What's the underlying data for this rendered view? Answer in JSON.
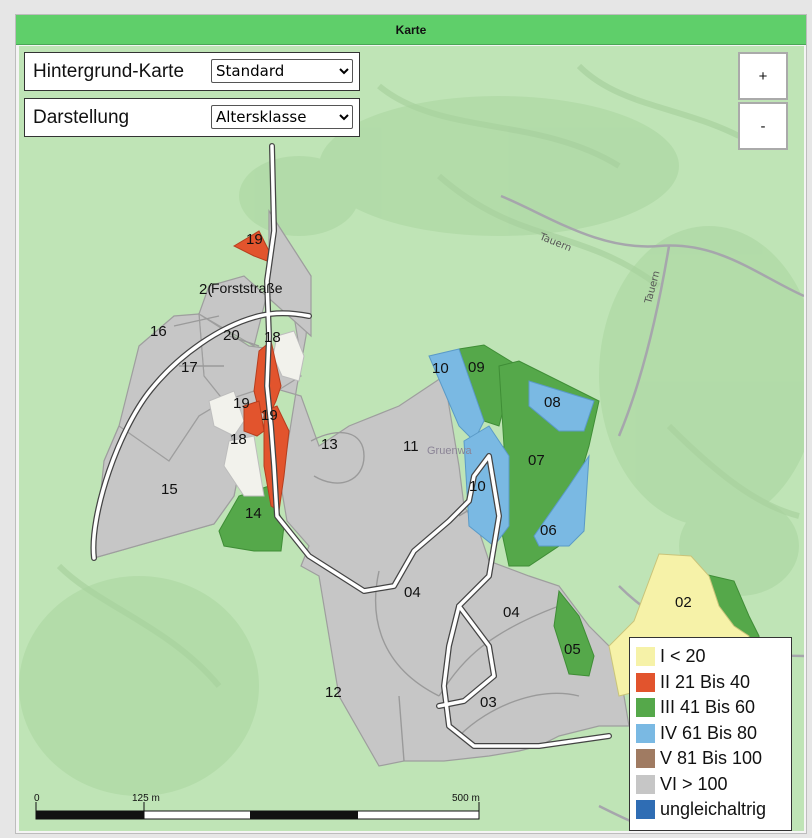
{
  "header": {
    "title": "Karte"
  },
  "controls": {
    "background_map": {
      "label": "Hintergrund-Karte",
      "selected": "Standard"
    },
    "display": {
      "label": "Darstellung",
      "selected": "Altersklasse"
    }
  },
  "zoom": {
    "in_label": "+",
    "out_label": "-"
  },
  "legend": {
    "items": [
      {
        "label": "I < 20",
        "color": "#f6f2a8"
      },
      {
        "label": "II 21 Bis 40",
        "color": "#e2542d"
      },
      {
        "label": "III 41 Bis 60",
        "color": "#55a84a"
      },
      {
        "label": "IV 61 Bis 80",
        "color": "#7ab9e3"
      },
      {
        "label": "V 81 Bis 100",
        "color": "#a07b62"
      },
      {
        "label": "VI > 100",
        "color": "#c6c6c6"
      },
      {
        "label": "ungleichaltrig",
        "color": "#2f6db4"
      }
    ]
  },
  "scale_bar": {
    "labels": [
      "0",
      "125 m",
      "500 m"
    ]
  },
  "map": {
    "road_labels": [
      "Tauern",
      "Tauern"
    ],
    "street_label": "Forststraße",
    "faint_label": "Gruenwa",
    "stand_labels": [
      "19",
      "2(",
      "16",
      "20",
      "18",
      "17",
      "19",
      "19",
      "18",
      "13",
      "11",
      "10",
      "09",
      "08",
      "07",
      "10",
      "06",
      "15",
      "14",
      "04",
      "04",
      "02",
      "05",
      "12",
      "03"
    ]
  }
}
